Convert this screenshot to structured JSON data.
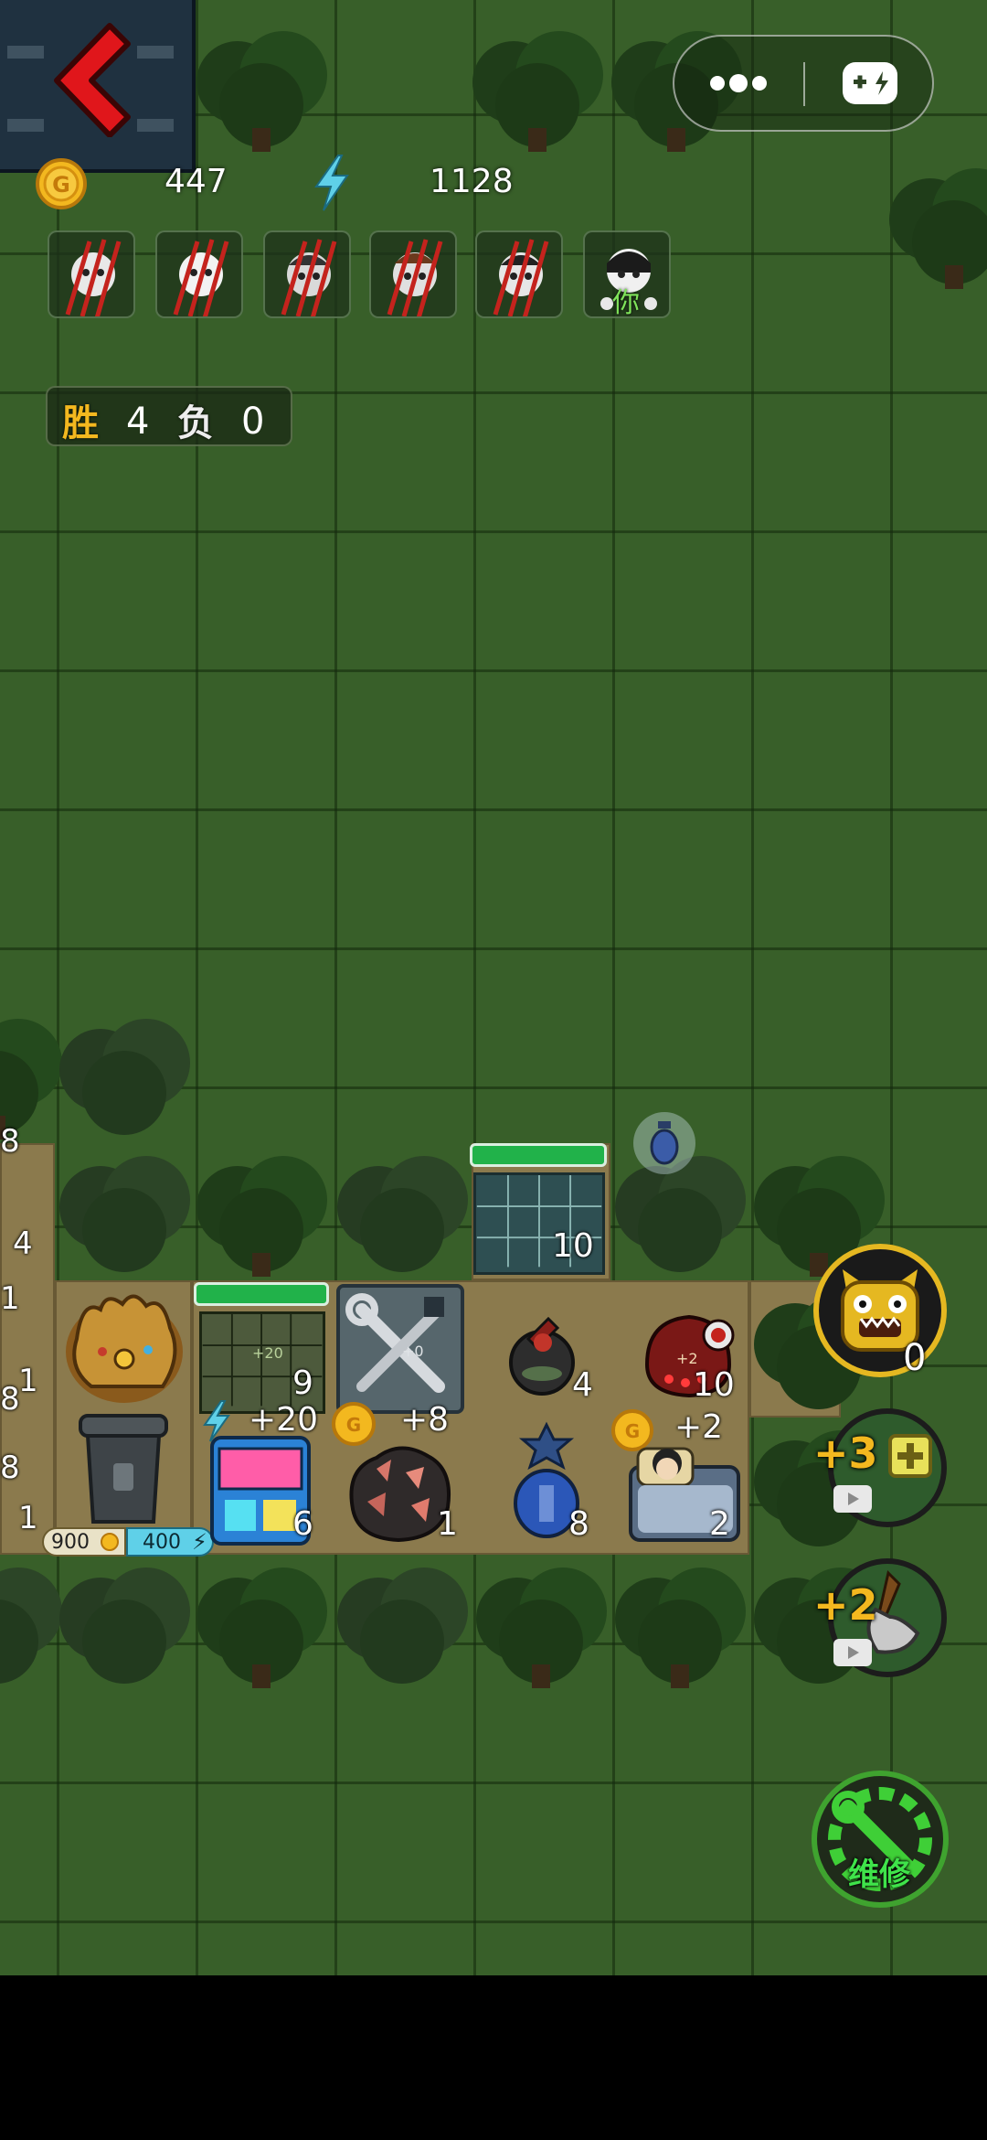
{
  "hud": {
    "gold": "447",
    "energy": "1128"
  },
  "record": {
    "win_label": "胜",
    "win_count": "4",
    "loss_label": "负",
    "loss_count": "0"
  },
  "opponents": {
    "self_label": "你"
  },
  "board": {
    "vault_count": "10",
    "locker_count": "9",
    "toolbox_hint": "+0",
    "vending_bonus": "+20",
    "vending_count": "6",
    "ore_bonus": "+8",
    "ore_count": "1",
    "potion_bottle_count": "4",
    "red_device_count": "10",
    "red_device_hint": "+2",
    "blue_lamp_count": "8",
    "bed_bonus": "+2",
    "bed_count": "2",
    "trash_gold_cost": "900",
    "trash_energy_cost": "400",
    "locker_hint": "+20",
    "edge_counts": [
      "8",
      "4",
      "1",
      "1",
      "8",
      "8",
      "1"
    ]
  },
  "side": {
    "monster_count": "0",
    "build_bonus": "+3",
    "dig_bonus": "+2",
    "repair_label": "维修"
  },
  "colors": {
    "grass": "#385f29",
    "grid": "#1a3310",
    "dirt": "#8b7a4d",
    "bar_green": "#21b24a",
    "gold": "#f3b81f",
    "energy": "#5fd0e8",
    "back_arrow": "#e0161b"
  }
}
